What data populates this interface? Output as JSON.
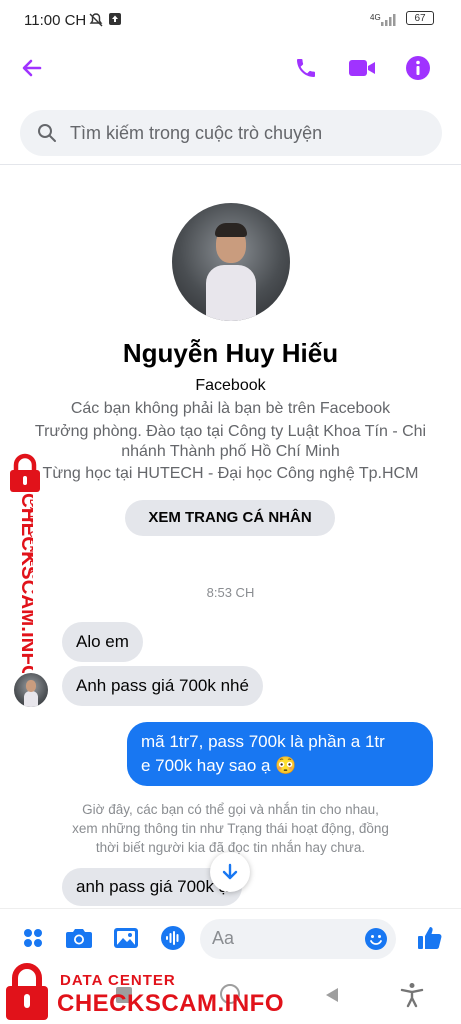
{
  "status_bar": {
    "time": "11:00 CH",
    "network": "4G",
    "battery": "67"
  },
  "search": {
    "placeholder": "Tìm kiếm trong cuộc trò chuyện"
  },
  "profile": {
    "name": "Nguyễn Huy Hiếu",
    "platform": "Facebook",
    "relation": "Các bạn không phải là bạn bè trên Facebook",
    "work_line1": "Trưởng phòng. Đào tạo tại Công ty Luật Khoa Tín - Chi",
    "work_line2": "nhánh Thành phố Hồ Chí Minh",
    "education": "Từng học tại HUTECH - Đại học Công nghệ Tp.HCM",
    "view_profile_label": "XEM TRANG CÁ NHÂN"
  },
  "conversation": {
    "timestamp": "8:53 CH",
    "messages": [
      {
        "from": "them",
        "text": "Alo em"
      },
      {
        "from": "them",
        "text": "Anh pass giá 700k nhé"
      },
      {
        "from": "me",
        "line1": "mã 1tr7, pass 700k là phần a 1tr",
        "line2": "e 700k hay sao ạ 😳"
      },
      {
        "from": "them",
        "text": "anh pass giá 700k ạ"
      }
    ],
    "notice_line1": "Giờ đây, các bạn có thể gọi và nhắn tin cho nhau,",
    "notice_line2": "xem những thông tin như Trạng thái hoạt động, đồng",
    "notice_line3": "thời biết người kia đã đọc tin nhắn hay chưa."
  },
  "composer": {
    "placeholder": "Aa"
  },
  "watermark": {
    "label_small": "DATA CENTER",
    "label_big": "CHECKSCAM.INFO"
  },
  "colors": {
    "messenger_purple": "#a033ff",
    "blue": "#1877f2",
    "watermark_red": "#e1121a"
  }
}
